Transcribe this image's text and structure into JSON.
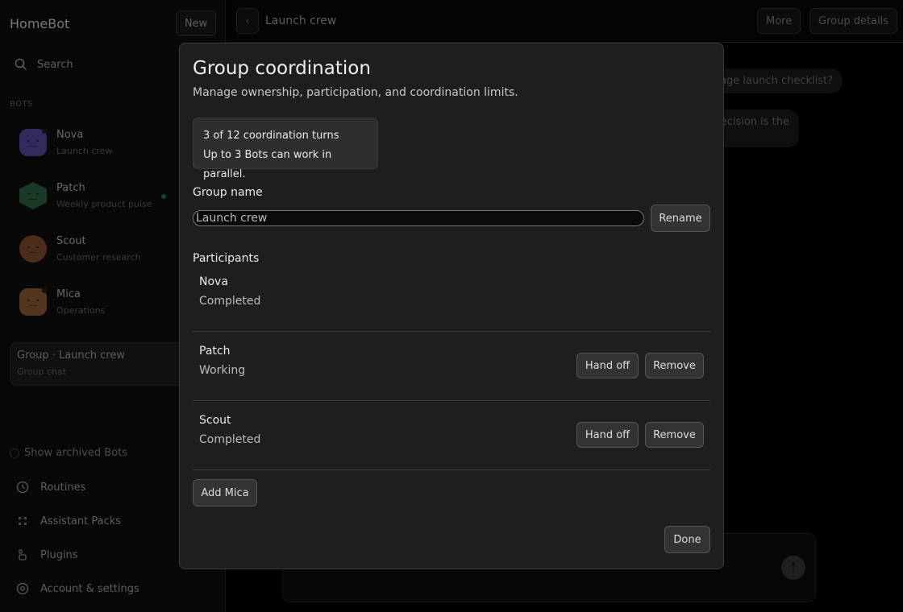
{
  "sidebar": {
    "brand": "HomeBot",
    "new_label": "New",
    "search_label": "Search",
    "bots_header": "BOTS",
    "bots": [
      {
        "name": "Nova",
        "subtitle": "Launch crew",
        "color": "#5b4ba8"
      },
      {
        "name": "Patch",
        "subtitle": "Weekly product pulse",
        "color": "#2f6a46"
      },
      {
        "name": "Scout",
        "subtitle": "Customer research",
        "color": "#8a5130"
      },
      {
        "name": "Mica",
        "subtitle": "Operations",
        "color": "#96603a"
      }
    ],
    "group": {
      "title": "Group · Launch crew",
      "subtitle": "Group chat"
    },
    "show_archived": "Show archived Bots",
    "nav": [
      {
        "label": "Routines",
        "icon": "clock-icon"
      },
      {
        "label": "Assistant Packs",
        "icon": "grid-icon"
      },
      {
        "label": "Plugins",
        "icon": "plug-icon"
      },
      {
        "label": "Account & settings",
        "icon": "settings-icon"
      }
    ]
  },
  "header": {
    "back_label": "‹",
    "title": "Launch crew",
    "more_label": "More",
    "details_label": "Group details"
  },
  "chat": {
    "bubble1": "page launch checklist?",
    "bubble2": "ecision is the"
  },
  "modal": {
    "title": "Group coordination",
    "subtitle": "Manage ownership, participation, and coordination limits.",
    "turns": "3 of 12 coordination turns",
    "parallel": "Up to 3 Bots can work in parallel.",
    "group_name_label": "Group name",
    "group_name_value": "Launch crew",
    "rename_label": "Rename",
    "participants_label": "Participants",
    "participants": [
      {
        "name": "Nova",
        "status": "Completed"
      },
      {
        "name": "Patch",
        "status": "Working",
        "handoff": "Hand off",
        "remove": "Remove"
      },
      {
        "name": "Scout",
        "status": "Completed",
        "handoff": "Hand off",
        "remove": "Remove"
      }
    ],
    "add_label": "Add Mica",
    "done_label": "Done"
  }
}
